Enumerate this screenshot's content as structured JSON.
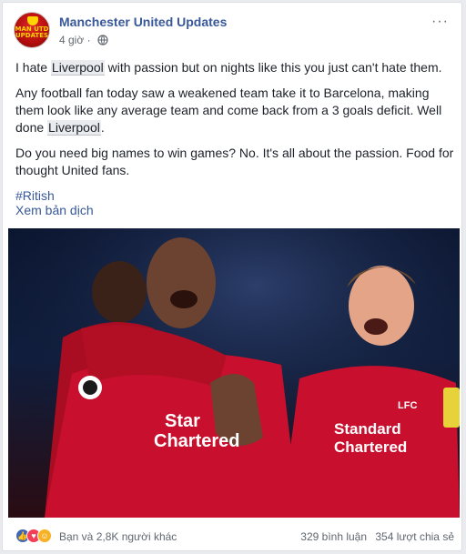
{
  "post": {
    "page_name": "Manchester United Updates",
    "time": "4 giờ",
    "avatar_text": [
      "MAN UTD",
      "UPDATES"
    ],
    "paragraphs": [
      {
        "before": "I hate ",
        "keyword": "Liverpool",
        "after": " with passion but on nights like this you just can't hate them."
      },
      {
        "before": "Any football fan today saw a weakened team take it to Barcelona, making them look like any average team and come back from a 3 goals deficit. Well done ",
        "keyword": "Liverpool",
        "after": "."
      },
      {
        "before": "Do you need big names to win games? No. It's all about the passion. Food for thought United fans.",
        "keyword": "",
        "after": ""
      }
    ],
    "hashtag": "#Ritish",
    "translate_link": "Xem bản dịch"
  },
  "photo": {
    "sponsor_center": [
      "Star",
      "Chartered"
    ],
    "sponsor_right": [
      "Standard",
      "Chartered"
    ],
    "club_badge": "LFC"
  },
  "reactions": {
    "icons": [
      "like-icon",
      "love-icon",
      "haha-icon"
    ],
    "names": "Bạn và 2,8K người khác",
    "comments": "329 bình luận",
    "shares": "354 lượt chia sẻ"
  },
  "colors": {
    "link": "#385898",
    "shirt": "#c8102e",
    "like": "#4267b2",
    "love": "#f33e58",
    "haha": "#f7b125"
  }
}
